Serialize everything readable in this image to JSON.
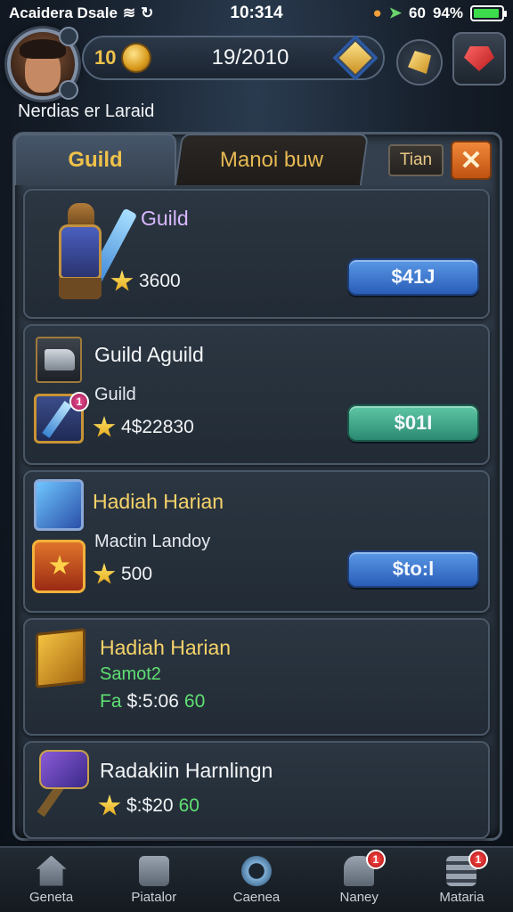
{
  "status_bar": {
    "carrier": "Acaidera Dsale",
    "time": "10:314",
    "signal": "60",
    "battery_text": "94%",
    "battery_level": 0.94
  },
  "header": {
    "level": "10",
    "currency_value": "19/2010",
    "player_name": "Nerdias er Laraid"
  },
  "tabs": {
    "active": "Guild",
    "inactive": "Manoi buw",
    "small": "Tian",
    "close": "✕"
  },
  "cards": [
    {
      "title": "Guild",
      "subtitle": "",
      "reward": "3600",
      "button": "$41J"
    },
    {
      "title": "Guild Aguild",
      "subtitle": "Guild",
      "reward": "4$22830",
      "button": "$01I",
      "badge": "1"
    },
    {
      "title": "Hadiah Harian",
      "subtitle": "Mactin Landoy",
      "reward": "500",
      "button": "$to:l"
    },
    {
      "title": "Hadiah Harian",
      "subtitle": "Samot2",
      "reward_prefix": "Fa",
      "reward": "$:5:06",
      "reward_suffix": "60"
    },
    {
      "title": "Radakiin Harnlingn",
      "subtitle": "",
      "reward": "$:$20",
      "reward_suffix": "60"
    }
  ],
  "bottom_nav": [
    {
      "label": "Geneta",
      "icon": "home-icon"
    },
    {
      "label": "Piatalor",
      "icon": "chest-icon"
    },
    {
      "label": "Caenea",
      "icon": "search-icon"
    },
    {
      "label": "Naney",
      "icon": "helmet-icon",
      "badge": "1"
    },
    {
      "label": "Mataria",
      "icon": "menu-icon",
      "badge": "1"
    }
  ],
  "colors": {
    "accent_gold": "#f0c24a",
    "button_blue": "#2a5eb8",
    "button_teal": "#2a8a72",
    "close_orange": "#e06a22",
    "reward_green": "#5fe072"
  }
}
